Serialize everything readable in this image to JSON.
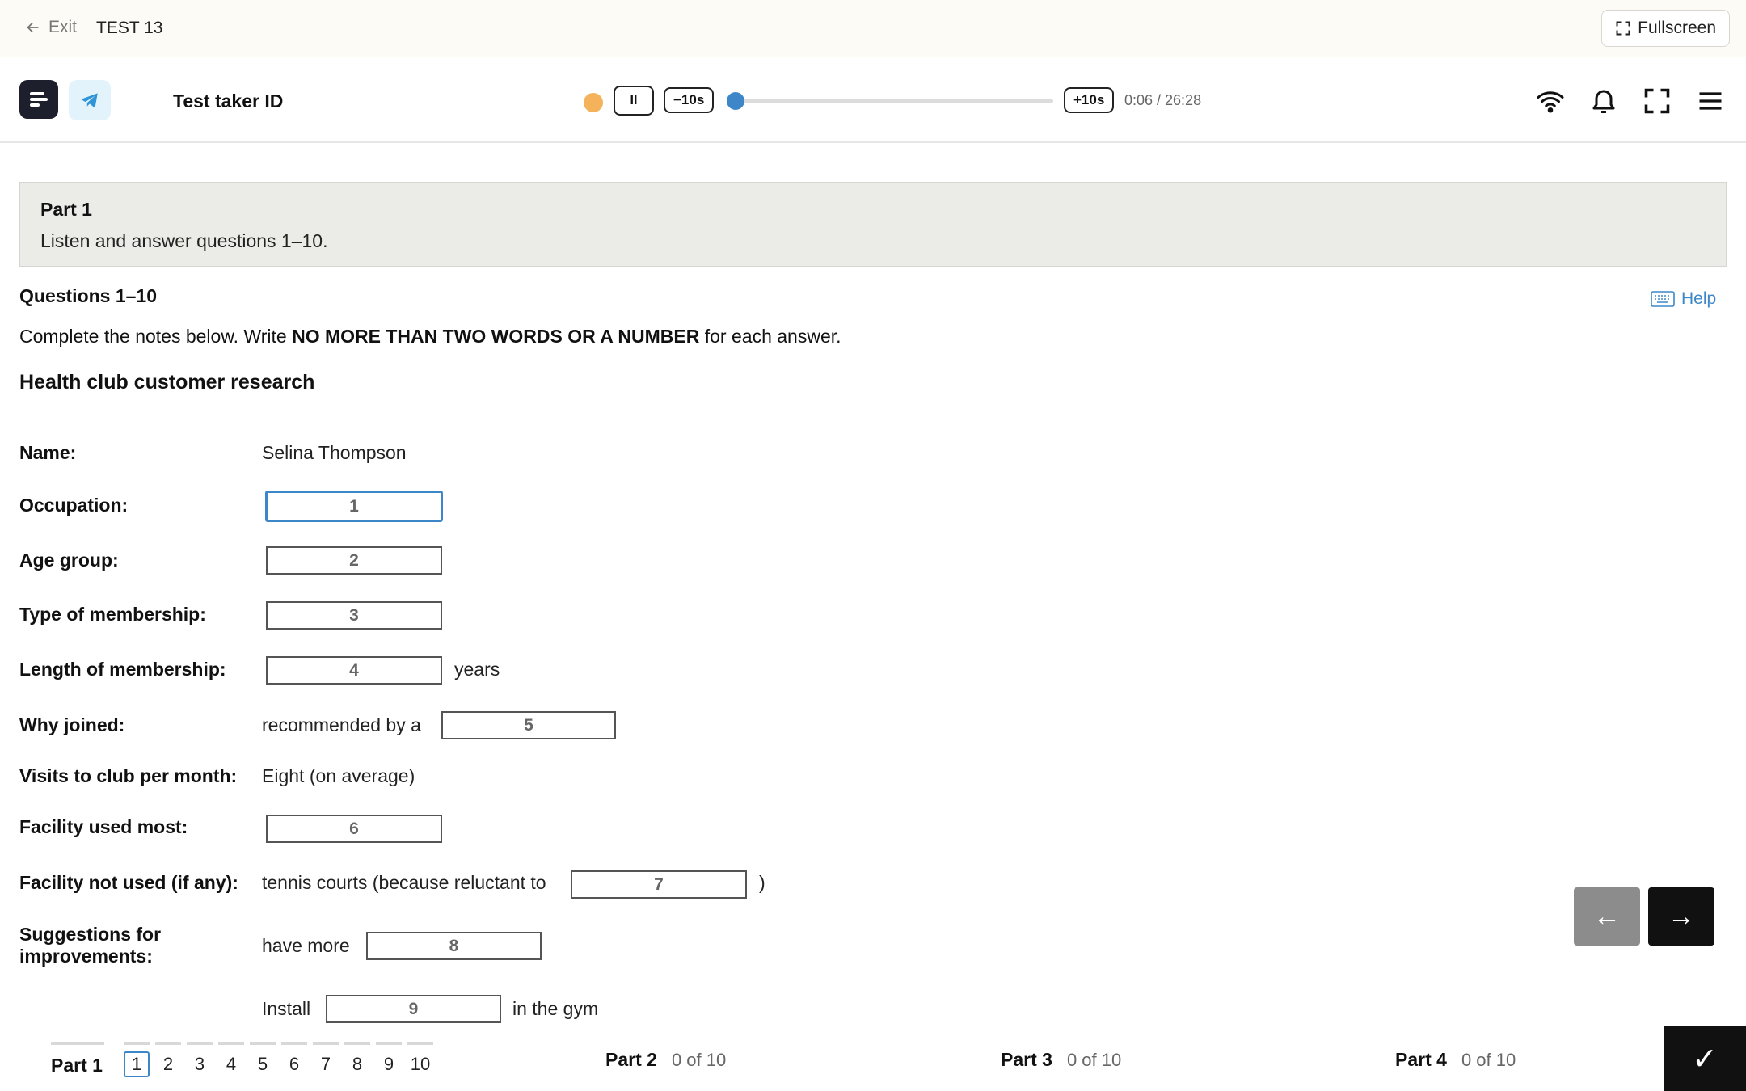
{
  "topbar": {
    "exit_label": "Exit",
    "test_title": "TEST 13",
    "fullscreen_label": "Fullscreen"
  },
  "player": {
    "test_taker_label": "Test taker ID",
    "back_label": "−10s",
    "forward_label": "+10s",
    "pause_glyph": "II",
    "time": "0:06 / 26:28",
    "progress": 0.004
  },
  "part": {
    "title": "Part 1",
    "instruction": "Listen and answer questions 1–10."
  },
  "questions": {
    "heading": "Questions 1–10",
    "help_label": "Help",
    "instruction_pre": "Complete the notes below. Write ",
    "instruction_bold": "NO MORE THAN TWO WORDS OR A NUMBER",
    "instruction_post": " for each answer.",
    "notes_title": "Health club customer research"
  },
  "rows": [
    {
      "label": "Name:",
      "text": "Selina Thompson"
    },
    {
      "label": "Occupation:",
      "box": "1"
    },
    {
      "label": "Age group:",
      "box": "2"
    },
    {
      "label": "Type of membership:",
      "box": "3"
    },
    {
      "label": "Length of membership:",
      "box": "4",
      "after": "years"
    },
    {
      "label": "Why joined:",
      "before": "recommended by a",
      "box": "5"
    },
    {
      "label": "Visits to club per month:",
      "text": "Eight (on average)"
    },
    {
      "label": "Facility used most:",
      "box": "6"
    },
    {
      "label": "Facility not used (if any):",
      "before": "tennis courts (because reluctant to",
      "box": "7",
      "after": ")"
    },
    {
      "label_line1": "Suggestions for",
      "label_line2": "improvements:",
      "before": "have more",
      "box": "8"
    },
    {
      "before": "Install",
      "box": "9",
      "after": "in the gym"
    }
  ],
  "nav": {
    "prev_glyph": "←",
    "next_glyph": "→"
  },
  "footer": {
    "part1_label": "Part 1",
    "question_numbers": [
      "1",
      "2",
      "3",
      "4",
      "5",
      "6",
      "7",
      "8",
      "9",
      "10"
    ],
    "part2_label": "Part 2",
    "part2_progress": "0 of 10",
    "part3_label": "Part 3",
    "part3_progress": "0 of 10",
    "part4_label": "Part 4",
    "part4_progress": "0 of 10",
    "submit_glyph": "✓"
  },
  "colors": {
    "accent": "#3d87c8",
    "banner_bg": "#ebece7",
    "topbar_bg": "#fdfbf6",
    "dark": "#111111"
  }
}
